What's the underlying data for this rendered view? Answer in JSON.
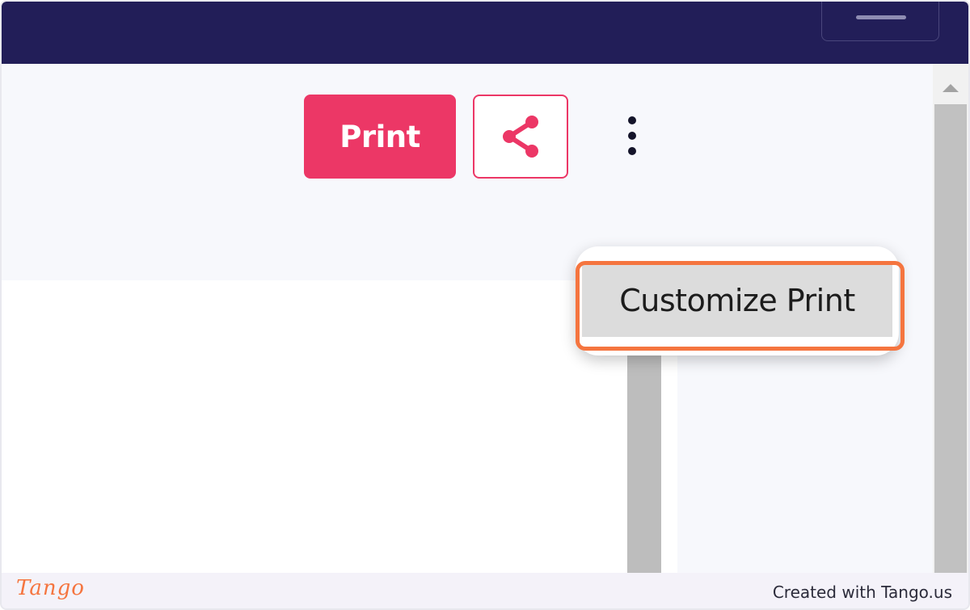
{
  "header": {
    "menu_icon": "hamburger-icon"
  },
  "toolbar": {
    "print_label": "Print",
    "share_icon": "share-icon",
    "more_icon": "kebab-menu-icon"
  },
  "dropdown": {
    "items": [
      {
        "label": "Customize Print"
      }
    ]
  },
  "footer": {
    "logo": "Tango",
    "credit": "Created with Tango.us"
  },
  "colors": {
    "header_bg": "#221e58",
    "accent": "#ec3766",
    "highlight": "#f5753f"
  }
}
